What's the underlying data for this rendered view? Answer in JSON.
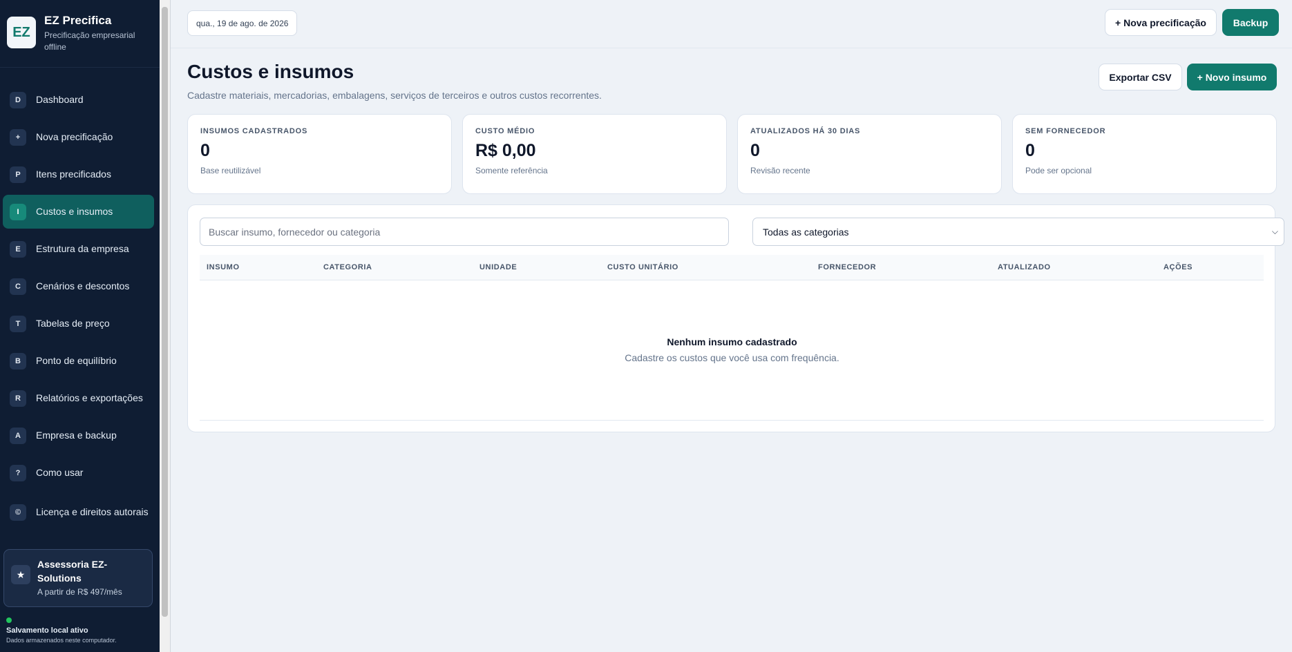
{
  "brand": {
    "logo": "EZ",
    "name": "EZ Precifica",
    "tagline": "Precificação empresarial offline"
  },
  "nav": [
    {
      "badge": "D",
      "label": "Dashboard"
    },
    {
      "badge": "+",
      "label": "Nova precificação"
    },
    {
      "badge": "P",
      "label": "Itens precificados"
    },
    {
      "badge": "I",
      "label": "Custos e insumos",
      "active": true
    },
    {
      "badge": "E",
      "label": "Estrutura da empresa"
    },
    {
      "badge": "C",
      "label": "Cenários e descontos"
    },
    {
      "badge": "T",
      "label": "Tabelas de preço"
    },
    {
      "badge": "B",
      "label": "Ponto de equilíbrio"
    },
    {
      "badge": "R",
      "label": "Relatórios e exportações"
    },
    {
      "badge": "A",
      "label": "Empresa e backup"
    },
    {
      "badge": "?",
      "label": "Como usar"
    },
    {
      "badge": "©",
      "label": "Licença e direitos autorais"
    }
  ],
  "promo": {
    "icon": "★",
    "title": "Assessoria EZ-Solutions",
    "subtitle": "A partir de R$ 497/mês"
  },
  "status": {
    "title": "Salvamento local ativo",
    "subtitle": "Dados armazenados neste computador."
  },
  "topbar": {
    "date": "qua., 19 de ago. de 2026",
    "new_pricing": "+ Nova precificação",
    "backup": "Backup"
  },
  "page": {
    "title": "Custos e insumos",
    "subtitle": "Cadastre materiais, mercadorias, embalagens, serviços de terceiros e outros custos recorrentes.",
    "export_csv": "Exportar CSV",
    "new_item": "+ Novo insumo"
  },
  "stats": [
    {
      "label": "INSUMOS CADASTRADOS",
      "value": "0",
      "note": "Base reutilizável"
    },
    {
      "label": "CUSTO MÉDIO",
      "value": "R$ 0,00",
      "note": "Somente referência"
    },
    {
      "label": "ATUALIZADOS HÁ 30 DIAS",
      "value": "0",
      "note": "Revisão recente"
    },
    {
      "label": "SEM FORNECEDOR",
      "value": "0",
      "note": "Pode ser opcional"
    }
  ],
  "filters": {
    "search_placeholder": "Buscar insumo, fornecedor ou categoria",
    "category_selected": "Todas as categorias"
  },
  "table": {
    "columns": [
      "INSUMO",
      "CATEGORIA",
      "UNIDADE",
      "CUSTO UNITÁRIO",
      "FORNECEDOR",
      "ATUALIZADO",
      "AÇÕES"
    ],
    "empty_title": "Nenhum insumo cadastrado",
    "empty_subtitle": "Cadastre os custos que você usa com frequência."
  },
  "colors": {
    "sidebar": "#0f1d33",
    "accent": "#117a6d",
    "active_nav": "#0f5f5e",
    "background": "#eef2f7",
    "status_dot": "#22c55e"
  }
}
